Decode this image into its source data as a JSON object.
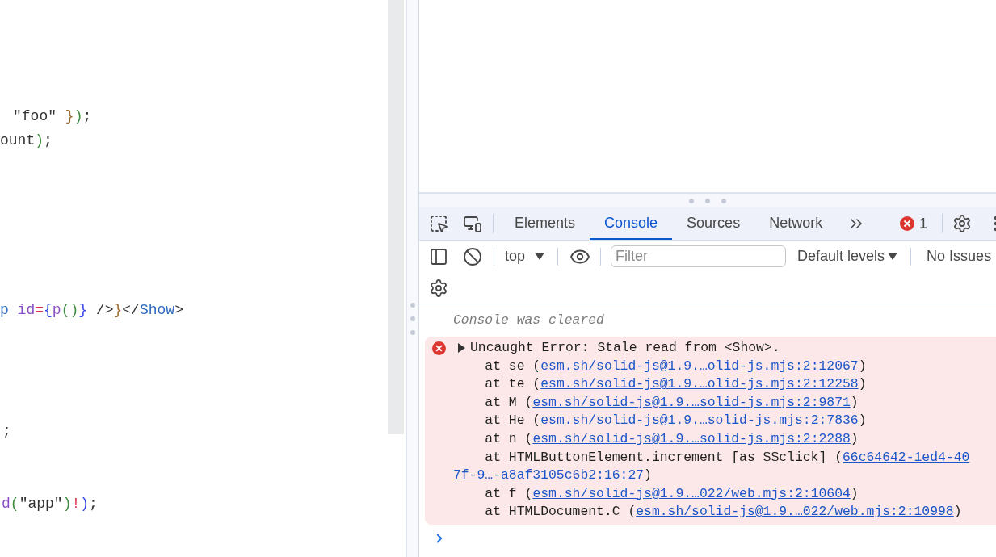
{
  "editor": {
    "lines": [
      {
        "tokens": [
          {
            "kind": "text",
            "text": "\"foo\" "
          },
          {
            "kind": "brace",
            "text": "}"
          },
          {
            "kind": "paren",
            "text": ")"
          },
          {
            "kind": "text",
            "text": ";"
          }
        ]
      },
      {
        "tokens": [
          {
            "kind": "text",
            "text": "ount"
          },
          {
            "kind": "paren",
            "text": ")"
          },
          {
            "kind": "text",
            "text": ";"
          }
        ]
      },
      {
        "tokens": [
          {
            "kind": "tag",
            "text": "p "
          },
          {
            "kind": "attr",
            "text": "id"
          },
          {
            "kind": "op",
            "text": "="
          },
          {
            "kind": "jsx",
            "text": "{"
          },
          {
            "kind": "attr",
            "text": "p"
          },
          {
            "kind": "paren",
            "text": "()"
          },
          {
            "kind": "jsx",
            "text": "}"
          },
          {
            "kind": "text",
            "text": " />"
          },
          {
            "kind": "brace",
            "text": "}"
          },
          {
            "kind": "text",
            "text": "</"
          },
          {
            "kind": "tag",
            "text": "Show"
          },
          {
            "kind": "text",
            "text": ">"
          }
        ]
      },
      {
        "tokens": [
          {
            "kind": "text",
            "text": ";"
          }
        ]
      },
      {
        "tokens": [
          {
            "kind": "attr",
            "text": "d"
          },
          {
            "kind": "paren",
            "text": "("
          },
          {
            "kind": "text",
            "text": "\"app\""
          },
          {
            "kind": "paren",
            "text": ")"
          },
          {
            "kind": "op",
            "text": "!"
          },
          {
            "kind": "jsx",
            "text": ")"
          },
          {
            "kind": "text",
            "text": ";"
          }
        ]
      }
    ]
  },
  "devtools": {
    "tabs": [
      {
        "label": "Elements",
        "selected": false
      },
      {
        "label": "Console",
        "selected": true
      },
      {
        "label": "Sources",
        "selected": false
      },
      {
        "label": "Network",
        "selected": false
      }
    ],
    "error_count": "1",
    "context": "top",
    "filter": {
      "placeholder": "Filter"
    },
    "levels": "Default levels",
    "issues": "No Issues",
    "console": {
      "cleared": "Console was cleared",
      "error": {
        "expanded": false,
        "message": "Uncaught Error: Stale read from <Show>.",
        "stack": [
          {
            "frame": "at se (",
            "link": "esm.sh/solid-js@1.9.…olid-js.mjs:2:12067",
            "end": ")"
          },
          {
            "frame": "at te (",
            "link": "esm.sh/solid-js@1.9.…olid-js.mjs:2:12258",
            "end": ")"
          },
          {
            "frame": "at M (",
            "link": "esm.sh/solid-js@1.9.…solid-js.mjs:2:9871",
            "end": ")"
          },
          {
            "frame": "at He (",
            "link": "esm.sh/solid-js@1.9.…solid-js.mjs:2:7836",
            "end": ")"
          },
          {
            "frame": "at n (",
            "link": "esm.sh/solid-js@1.9.…solid-js.mjs:2:2288",
            "end": ")"
          },
          {
            "frame": "at HTMLButtonElement.increment [as $$click] (",
            "link": "66c64642-1ed4-40",
            "link_continued": "7f-9…-a8af3105c6b2:16:27",
            "end": ")"
          },
          {
            "frame": "at f (",
            "link": "esm.sh/solid-js@1.9.…022/web.mjs:2:10604",
            "end": ")"
          },
          {
            "frame": "at HTMLDocument.C (",
            "link": "esm.sh/solid-js@1.9.…022/web.mjs:2:10998",
            "end": ")"
          }
        ]
      }
    }
  }
}
